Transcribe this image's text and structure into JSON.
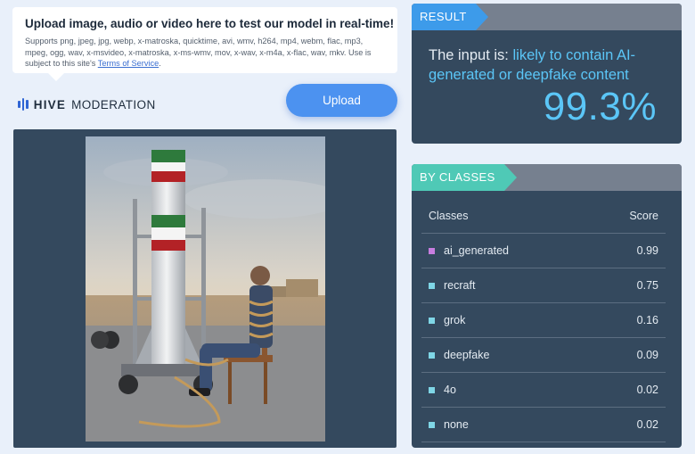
{
  "upload": {
    "title": "Upload image, audio or video here to test our model in real-time!",
    "supported": "Supports png, jpeg, jpg, webp, x-matroska, quicktime, avi, wmv, h264, mp4, webm, flac, mp3, mpeg, ogg, wav, x-msvideo, x-matroska, x-ms-wmv, mov, x-wav, x-m4a, x-flac, wav, mkv. Use is subject to this site's",
    "terms_link": "Terms of Service",
    "terms_suffix": ".",
    "button_label": "Upload"
  },
  "brand": {
    "name_bold": "HIVE",
    "name_rest": "MODERATION"
  },
  "result": {
    "tag": "RESULT",
    "prefix": "The input is:",
    "verdict": "likely to contain AI-generated or deepfake content",
    "score": "99.3%"
  },
  "classes": {
    "tag": "BY CLASSES",
    "col_class": "Classes",
    "col_score": "Score",
    "rows": [
      {
        "name": "ai_generated",
        "score": "0.99",
        "color": "#c77ddf"
      },
      {
        "name": "recraft",
        "score": "0.75",
        "color": "#7fd6e6"
      },
      {
        "name": "grok",
        "score": "0.16",
        "color": "#7fd6e6"
      },
      {
        "name": "deepfake",
        "score": "0.09",
        "color": "#7fd6e6"
      },
      {
        "name": "4o",
        "score": "0.02",
        "color": "#7fd6e6"
      },
      {
        "name": "none",
        "score": "0.02",
        "color": "#7fd6e6"
      }
    ]
  },
  "colors": {
    "accent_blue": "#3d9bea",
    "accent_teal": "#4fc9b6",
    "panel_dark": "#34495e",
    "score_blue": "#5bc6f7",
    "button_blue": "#4c92f0"
  }
}
